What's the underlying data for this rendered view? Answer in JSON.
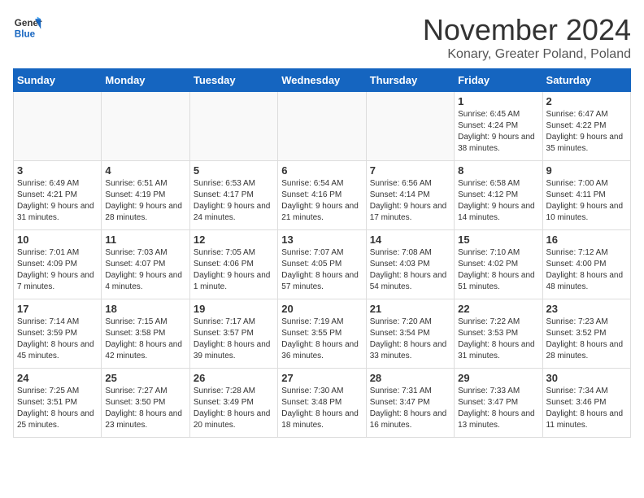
{
  "logo": {
    "line1": "General",
    "line2": "Blue"
  },
  "title": "November 2024",
  "location": "Konary, Greater Poland, Poland",
  "weekdays": [
    "Sunday",
    "Monday",
    "Tuesday",
    "Wednesday",
    "Thursday",
    "Friday",
    "Saturday"
  ],
  "weeks": [
    [
      {
        "num": "",
        "info": ""
      },
      {
        "num": "",
        "info": ""
      },
      {
        "num": "",
        "info": ""
      },
      {
        "num": "",
        "info": ""
      },
      {
        "num": "",
        "info": ""
      },
      {
        "num": "1",
        "info": "Sunrise: 6:45 AM\nSunset: 4:24 PM\nDaylight: 9 hours and 38 minutes."
      },
      {
        "num": "2",
        "info": "Sunrise: 6:47 AM\nSunset: 4:22 PM\nDaylight: 9 hours and 35 minutes."
      }
    ],
    [
      {
        "num": "3",
        "info": "Sunrise: 6:49 AM\nSunset: 4:21 PM\nDaylight: 9 hours and 31 minutes."
      },
      {
        "num": "4",
        "info": "Sunrise: 6:51 AM\nSunset: 4:19 PM\nDaylight: 9 hours and 28 minutes."
      },
      {
        "num": "5",
        "info": "Sunrise: 6:53 AM\nSunset: 4:17 PM\nDaylight: 9 hours and 24 minutes."
      },
      {
        "num": "6",
        "info": "Sunrise: 6:54 AM\nSunset: 4:16 PM\nDaylight: 9 hours and 21 minutes."
      },
      {
        "num": "7",
        "info": "Sunrise: 6:56 AM\nSunset: 4:14 PM\nDaylight: 9 hours and 17 minutes."
      },
      {
        "num": "8",
        "info": "Sunrise: 6:58 AM\nSunset: 4:12 PM\nDaylight: 9 hours and 14 minutes."
      },
      {
        "num": "9",
        "info": "Sunrise: 7:00 AM\nSunset: 4:11 PM\nDaylight: 9 hours and 10 minutes."
      }
    ],
    [
      {
        "num": "10",
        "info": "Sunrise: 7:01 AM\nSunset: 4:09 PM\nDaylight: 9 hours and 7 minutes."
      },
      {
        "num": "11",
        "info": "Sunrise: 7:03 AM\nSunset: 4:07 PM\nDaylight: 9 hours and 4 minutes."
      },
      {
        "num": "12",
        "info": "Sunrise: 7:05 AM\nSunset: 4:06 PM\nDaylight: 9 hours and 1 minute."
      },
      {
        "num": "13",
        "info": "Sunrise: 7:07 AM\nSunset: 4:05 PM\nDaylight: 8 hours and 57 minutes."
      },
      {
        "num": "14",
        "info": "Sunrise: 7:08 AM\nSunset: 4:03 PM\nDaylight: 8 hours and 54 minutes."
      },
      {
        "num": "15",
        "info": "Sunrise: 7:10 AM\nSunset: 4:02 PM\nDaylight: 8 hours and 51 minutes."
      },
      {
        "num": "16",
        "info": "Sunrise: 7:12 AM\nSunset: 4:00 PM\nDaylight: 8 hours and 48 minutes."
      }
    ],
    [
      {
        "num": "17",
        "info": "Sunrise: 7:14 AM\nSunset: 3:59 PM\nDaylight: 8 hours and 45 minutes."
      },
      {
        "num": "18",
        "info": "Sunrise: 7:15 AM\nSunset: 3:58 PM\nDaylight: 8 hours and 42 minutes."
      },
      {
        "num": "19",
        "info": "Sunrise: 7:17 AM\nSunset: 3:57 PM\nDaylight: 8 hours and 39 minutes."
      },
      {
        "num": "20",
        "info": "Sunrise: 7:19 AM\nSunset: 3:55 PM\nDaylight: 8 hours and 36 minutes."
      },
      {
        "num": "21",
        "info": "Sunrise: 7:20 AM\nSunset: 3:54 PM\nDaylight: 8 hours and 33 minutes."
      },
      {
        "num": "22",
        "info": "Sunrise: 7:22 AM\nSunset: 3:53 PM\nDaylight: 8 hours and 31 minutes."
      },
      {
        "num": "23",
        "info": "Sunrise: 7:23 AM\nSunset: 3:52 PM\nDaylight: 8 hours and 28 minutes."
      }
    ],
    [
      {
        "num": "24",
        "info": "Sunrise: 7:25 AM\nSunset: 3:51 PM\nDaylight: 8 hours and 25 minutes."
      },
      {
        "num": "25",
        "info": "Sunrise: 7:27 AM\nSunset: 3:50 PM\nDaylight: 8 hours and 23 minutes."
      },
      {
        "num": "26",
        "info": "Sunrise: 7:28 AM\nSunset: 3:49 PM\nDaylight: 8 hours and 20 minutes."
      },
      {
        "num": "27",
        "info": "Sunrise: 7:30 AM\nSunset: 3:48 PM\nDaylight: 8 hours and 18 minutes."
      },
      {
        "num": "28",
        "info": "Sunrise: 7:31 AM\nSunset: 3:47 PM\nDaylight: 8 hours and 16 minutes."
      },
      {
        "num": "29",
        "info": "Sunrise: 7:33 AM\nSunset: 3:47 PM\nDaylight: 8 hours and 13 minutes."
      },
      {
        "num": "30",
        "info": "Sunrise: 7:34 AM\nSunset: 3:46 PM\nDaylight: 8 hours and 11 minutes."
      }
    ]
  ]
}
